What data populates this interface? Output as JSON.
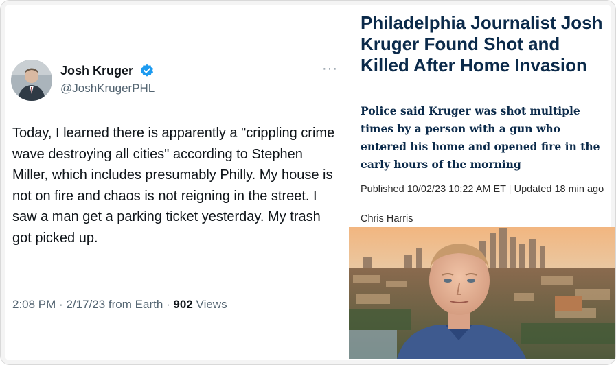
{
  "tweet": {
    "author_name": "Josh Kruger",
    "author_handle": "@JoshKrugerPHL",
    "more_menu": "···",
    "text": "Today, I learned there is apparently a \"crippling crime wave destroying all cities\" according to Stephen Miller, which includes presumably Philly. My house is not on fire and chaos is not reigning in the street. I saw a man get a parking ticket yesterday. My trash got picked up.",
    "time": "2:08 PM",
    "date": "2/17/23",
    "source": "from Earth",
    "views_count": "902",
    "views_label": "Views",
    "separator": "·",
    "verified_color": "#1d9bf0"
  },
  "article": {
    "headline": "Philadelphia Journalist Josh Kruger Found Shot and Killed After Home Invasion",
    "dek": "Police said Kruger was shot multiple times by a person with a gun who entered his home and opened fire in the early hours of the morning",
    "published": "Published 10/02/23 10:22 AM ET",
    "separator": "|",
    "updated": "Updated 18 min ago",
    "author": "Chris Harris",
    "headline_color": "#0b2a4a"
  }
}
